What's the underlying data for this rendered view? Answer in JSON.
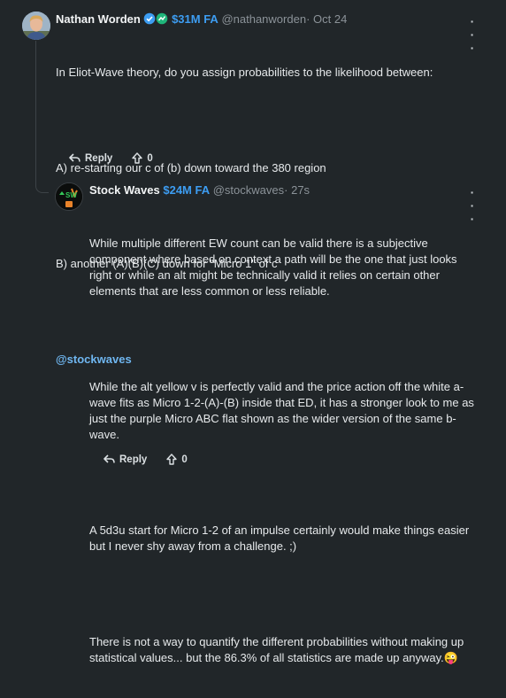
{
  "posts": [
    {
      "author_name": "Nathan Worden",
      "market_cap": "$31M FA",
      "handle": "@nathanworden",
      "separator": "·",
      "date": "Oct 24",
      "paragraphs": [
        "In Eliot-Wave theory, do you assign probabilities to the likelihood between:",
        "A) re-starting our c of (b) down toward the 380 region",
        "B) another (A)(B)(C) down for \"Micro 1\" of c"
      ],
      "mention": "@stockwaves",
      "reply_label": "Reply",
      "upvote_count": "0"
    },
    {
      "author_name": "Stock Waves",
      "market_cap": "$24M FA",
      "handle": "@stockwaves",
      "separator": "·",
      "date": "27s",
      "avatar_text": "SW",
      "paragraphs": [
        "While multiple different EW count can be valid there is a subjective\ncomponent where based on context a path will be the one that just looks\nright or while an alt might be technically valid it relies on certain other\nelements that are less common or less reliable.",
        "While the alt yellow v is perfectly valid and the price action off the white a-\nwave fits as Micro 1-2-(A)-(B) inside that ED, it has a stronger look to me as\njust the purple Micro ABC flat shown as the wider version of the same b-\nwave.",
        "A 5d3u start for Micro 1-2 of an impulse certainly would make things easier\nbut I never shy away from a challenge. ;)",
        "There is not a way to quantify the different probabilities without making up\nstatistical values... but the 86.3% of all statistics are made up anyway.😜"
      ],
      "reply_label": "Reply",
      "upvote_count": "0"
    }
  ],
  "colors": {
    "background": "#212629",
    "market_cap": "#3d9df2",
    "link": "#6fb6f0",
    "handle": "#8b9298"
  }
}
